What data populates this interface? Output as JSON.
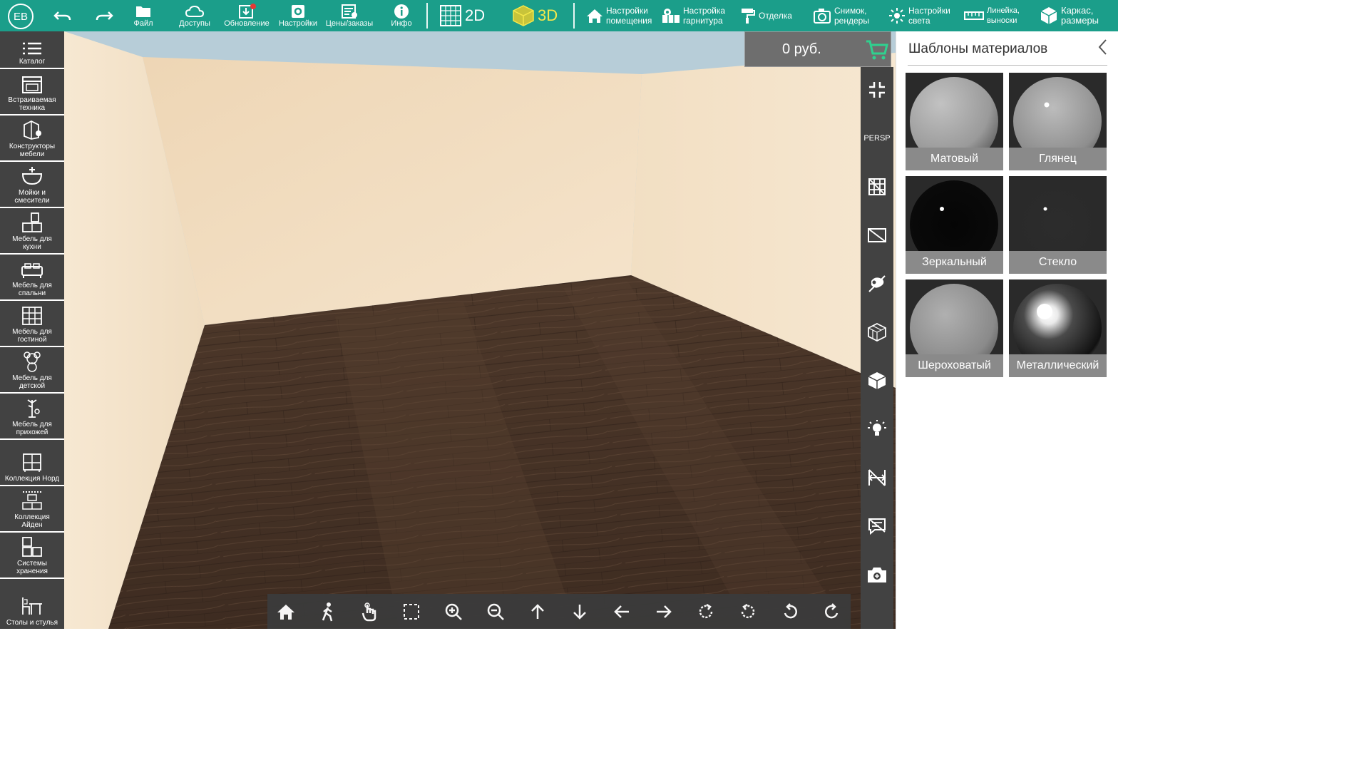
{
  "user": {
    "initials": "ЕВ"
  },
  "toolbar": {
    "file": "Файл",
    "access": "Доступы",
    "update": "Обновление",
    "settings": "Настройки",
    "prices": "Цены/заказы",
    "info": "Инфо",
    "view2d": "2D",
    "view3d": "3D",
    "room_settings": [
      "Настройки",
      "помещения"
    ],
    "set_settings": [
      "Настройка",
      "гарнитура"
    ],
    "finish": "Отделка",
    "snapshot": [
      "Снимок,",
      "рендеры"
    ],
    "light_settings": [
      "Настройки",
      "света"
    ],
    "ruler": [
      "Линейка,",
      "выноски"
    ],
    "frame": [
      "Каркас,",
      "размеры"
    ]
  },
  "sidebar": {
    "items": [
      {
        "lines": [
          "Каталог"
        ]
      },
      {
        "lines": [
          "Встраиваемая",
          "техника"
        ]
      },
      {
        "lines": [
          "Конструкторы",
          "мебели"
        ]
      },
      {
        "lines": [
          "Мойки и",
          "смесители"
        ]
      },
      {
        "lines": [
          "Мебель для",
          "кухни"
        ]
      },
      {
        "lines": [
          "Мебель для",
          "спальни"
        ]
      },
      {
        "lines": [
          "Мебель для",
          "гостиной"
        ]
      },
      {
        "lines": [
          "Мебель для",
          "детской"
        ]
      },
      {
        "lines": [
          "Мебель для",
          "прихожей"
        ]
      },
      {
        "lines": [
          "Коллекция Норд"
        ]
      },
      {
        "lines": [
          "Коллекция",
          "Айден"
        ]
      },
      {
        "lines": [
          "Системы",
          "хранения"
        ]
      },
      {
        "lines": [
          "Столы и стулья"
        ]
      }
    ]
  },
  "price": {
    "value": "0 руб."
  },
  "right_tools": {
    "persp": "PERSP"
  },
  "material_panel": {
    "title": "Шаблоны материалов",
    "materials": [
      "Матовый",
      "Глянец",
      "Зеркальный",
      "Стекло",
      "Шероховатый",
      "Металлический"
    ]
  },
  "colors": {
    "accent": "#1b9e8a",
    "panel_dark": "#424242",
    "wall": "#f3dfc3",
    "floor": "#4a3426"
  }
}
